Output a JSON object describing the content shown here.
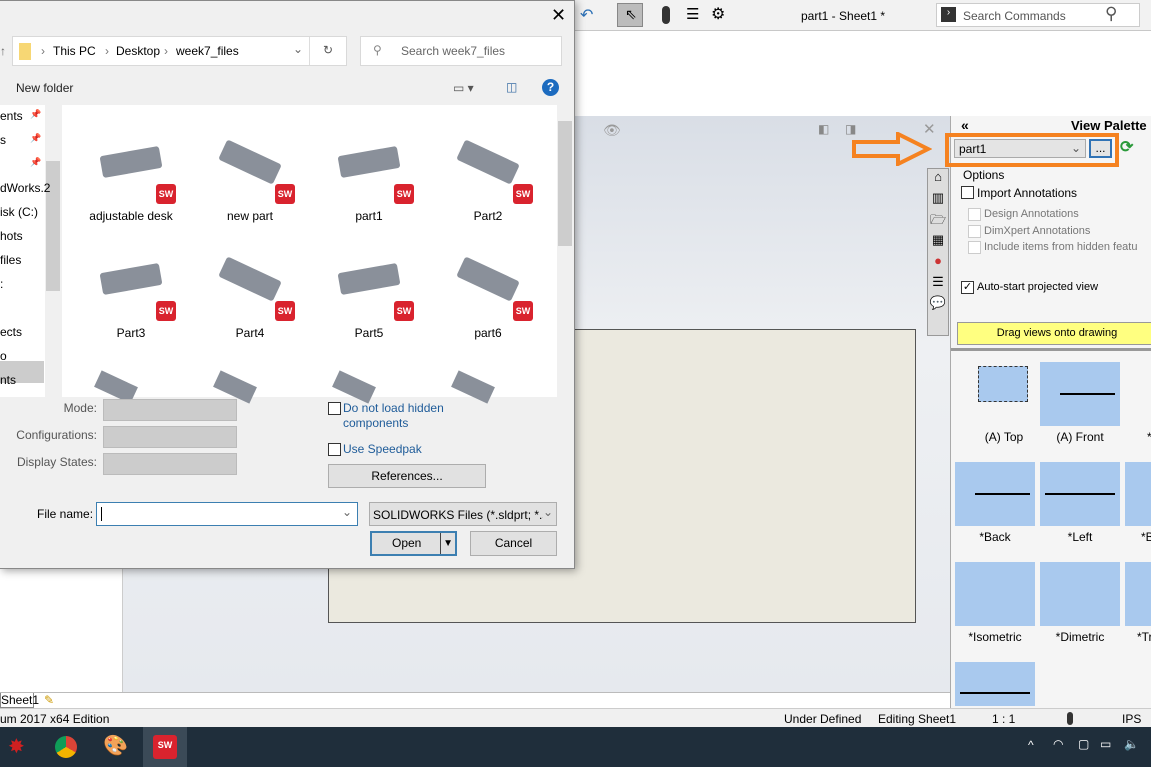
{
  "app": {
    "title": "part1 - Sheet1 *",
    "search_placeholder": "Search Commands",
    "sheet_tab": "Sheet1",
    "edition": "um 2017 x64 Edition",
    "status": {
      "defined": "Under Defined",
      "editing": "Editing Sheet1",
      "scale": "1 : 1",
      "units": "IPS"
    }
  },
  "palette": {
    "title": "View Palette",
    "collapse": "«",
    "document": "part1",
    "browse": "...",
    "options_label": "Options",
    "import_annotations": "Import Annotations",
    "design_annotations": "Design Annotations",
    "dimxpert_annotations": "DimXpert Annotations",
    "include_hidden": "Include items from hidden featu",
    "auto_start": "Auto-start projected view",
    "auto_start_checked": true,
    "drag_hint": "Drag views onto drawing",
    "views": [
      "(A) Top",
      "(A) Front",
      "*",
      "*Back",
      "*Left",
      "*B",
      "*Isometric",
      "*Dimetric",
      "*Tr",
      ""
    ],
    "highlight_color": "#f58220"
  },
  "dialog": {
    "breadcrumb": [
      "This PC",
      "Desktop",
      "week7_files"
    ],
    "search_placeholder": "Search week7_files",
    "new_folder": "New folder",
    "nav_items": [
      "ents",
      "s",
      "",
      "dWorks.2",
      "isk (C:)",
      "hots",
      "files",
      ":",
      "",
      "ects",
      "o",
      "nts"
    ],
    "files": [
      "adjustable desk",
      "new part",
      "part1",
      "Part2",
      "Part3",
      "Part4",
      "Part5",
      "part6"
    ],
    "mode_label": "Mode:",
    "config_label": "Configurations:",
    "display_label": "Display States:",
    "no_hidden": "Do not load hidden",
    "no_hidden2": "components",
    "speedpak": "Use Speedpak",
    "references": "References...",
    "filename_label": "File name:",
    "filename_value": "",
    "filter": "SOLIDWORKS Files (*.sldprt; *.sl",
    "open": "Open",
    "cancel": "Cancel"
  }
}
